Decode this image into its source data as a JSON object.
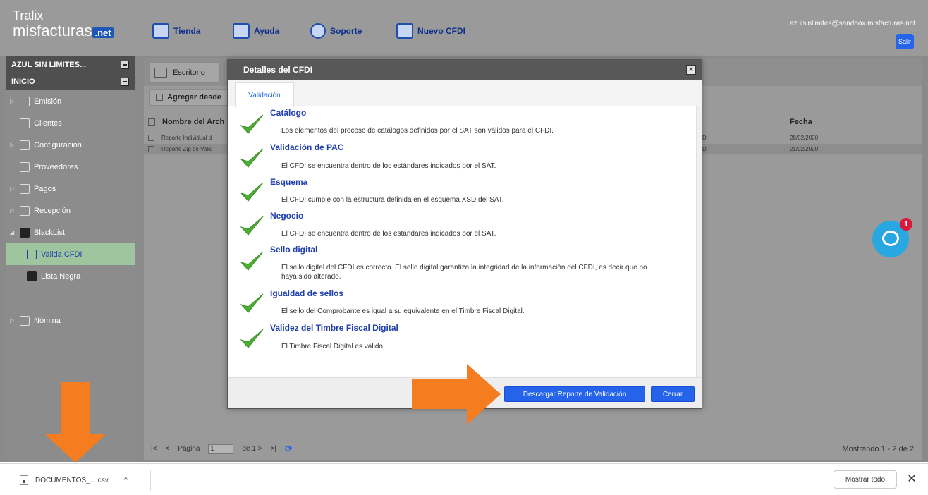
{
  "brand": {
    "logo_line1": "Tralix",
    "logo_line2": "misfacturas",
    "logo_suffix": ".net"
  },
  "topnav": [
    {
      "label": "Tienda"
    },
    {
      "label": "Ayuda"
    },
    {
      "label": "Soporte"
    },
    {
      "label": "Nuevo CFDI"
    }
  ],
  "user": {
    "email": "azulsinlimites@sandbox.misfacturas.net",
    "logout_label": "Salir"
  },
  "sidebar": {
    "company": "AZUL SIN LIMITES...",
    "section": "INICIO",
    "items": [
      {
        "label": "Emisión"
      },
      {
        "label": "Clientes"
      },
      {
        "label": "Configuración"
      },
      {
        "label": "Proveedores"
      },
      {
        "label": "Pagos"
      },
      {
        "label": "Recepción"
      },
      {
        "label": "BlackList"
      },
      {
        "label": "Valida CFDI"
      },
      {
        "label": "Lista Negra"
      },
      {
        "label": "Nómina"
      }
    ]
  },
  "main": {
    "tab_label": "Escritorio",
    "toolbar_label": "Agregar desde",
    "columns": {
      "name": "Nombre del Arch",
      "date": "Fecha"
    },
    "rows": [
      {
        "name": "Reporte Individual d",
        "d": "D",
        "date": "28/02/2020"
      },
      {
        "name": "Reporte Zip de Valid",
        "d": "D",
        "date": "21/02/2020"
      }
    ],
    "pager": {
      "first": "|<",
      "prev": "<",
      "page_label": "Página",
      "page_value": "1",
      "of_label": "de 1 >",
      "last": ">|",
      "status": "Mostrando 1 - 2 de 2"
    }
  },
  "modal": {
    "title": "Detalles del CFDI",
    "tab": "Validación",
    "close_glyph": "×",
    "validations": [
      {
        "title": "Catálogo",
        "desc": "Los elementos del proceso de catálogos definidos por el SAT son válidos para el CFDI."
      },
      {
        "title": "Validación de PAC",
        "desc": "El CFDI se encuentra dentro de los estándares indicados por el SAT."
      },
      {
        "title": "Esquema",
        "desc": "El CFDI cumple con la estructura definida en el esquema XSD del SAT."
      },
      {
        "title": "Negocio",
        "desc": "El CFDI se encuentra dentro de los estándares indicados por el SAT."
      },
      {
        "title": "Sello digital",
        "desc": "El sello digital del CFDI es correcto. El sello digital garantiza la integridad de la información del CFDI, es decir que no haya sido alterado."
      },
      {
        "title": "Igualdad de sellos",
        "desc": "El sello del Comprobante es igual a su equivalente en el Timbre Fiscal Digital."
      },
      {
        "title": "Validez del Timbre Fiscal Digital",
        "desc": "El Timbre Fiscal Digital es válido."
      }
    ],
    "download_button": "Descargar Reporte de Validación",
    "close_button": "Cerrar"
  },
  "chat": {
    "badge": "1"
  },
  "download_bar": {
    "file_name": "DOCUMENTOS_....csv",
    "chevron": "^",
    "show_all": "Mostrar todo",
    "close": "✕"
  },
  "colors": {
    "accent_blue": "#2563eb",
    "check_green": "#4caf33",
    "arrow_orange": "#f57c1f",
    "chat_blue": "#29a7e1",
    "badge_red": "#d81b3c"
  }
}
